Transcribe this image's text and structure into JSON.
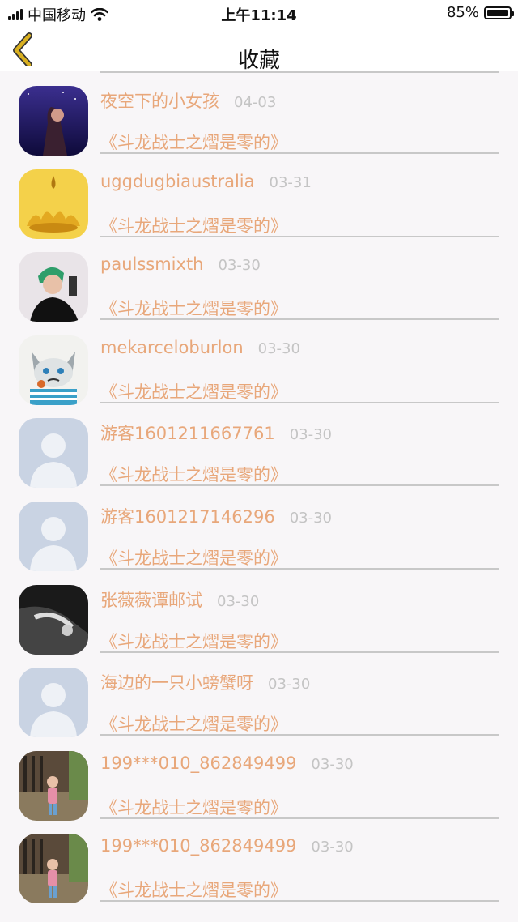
{
  "status": {
    "carrier": "中国移动",
    "time": "上午11:14",
    "battery": "85%"
  },
  "nav": {
    "title": "收藏",
    "back_icon": "chevron-left-icon",
    "accent_color": "#d9b020"
  },
  "items": [
    {
      "name": "夜空下的小女孩",
      "date": "04-03",
      "work": "《斗龙战士之熠是零的》",
      "avatar": "night-girl-avatar"
    },
    {
      "name": "uggdugbiaustralia",
      "date": "03-31",
      "work": "《斗龙战士之熠是零的》",
      "avatar": "golden-crown-avatar"
    },
    {
      "name": "paulssmixth",
      "date": "03-30",
      "work": "《斗龙战士之熠是零的》",
      "avatar": "boy-photo-avatar"
    },
    {
      "name": "mekarceloburlon",
      "date": "03-30",
      "work": "《斗龙战士之熠是零的》",
      "avatar": "grumpy-cat-avatar"
    },
    {
      "name": "游客1601211667761",
      "date": "03-30",
      "work": "《斗龙战士之熠是零的》",
      "avatar": "default-user-avatar"
    },
    {
      "name": "游客1601217146296",
      "date": "03-30",
      "work": "《斗龙战士之熠是零的》",
      "avatar": "default-user-avatar"
    },
    {
      "name": "张薇薇谭邮试",
      "date": "03-30",
      "work": "《斗龙战士之熠是零的》",
      "avatar": "dark-photo-avatar"
    },
    {
      "name": "海边的一只小螃蟹呀",
      "date": "03-30",
      "work": "《斗龙战士之熠是零的》",
      "avatar": "default-user-avatar"
    },
    {
      "name": "199***010_862849499",
      "date": "03-30",
      "work": "《斗龙战士之熠是零的》",
      "avatar": "child-photo-avatar"
    },
    {
      "name": "199***010_862849499",
      "date": "03-30",
      "work": "《斗龙战士之熠是零的》",
      "avatar": "child-photo-avatar"
    }
  ]
}
